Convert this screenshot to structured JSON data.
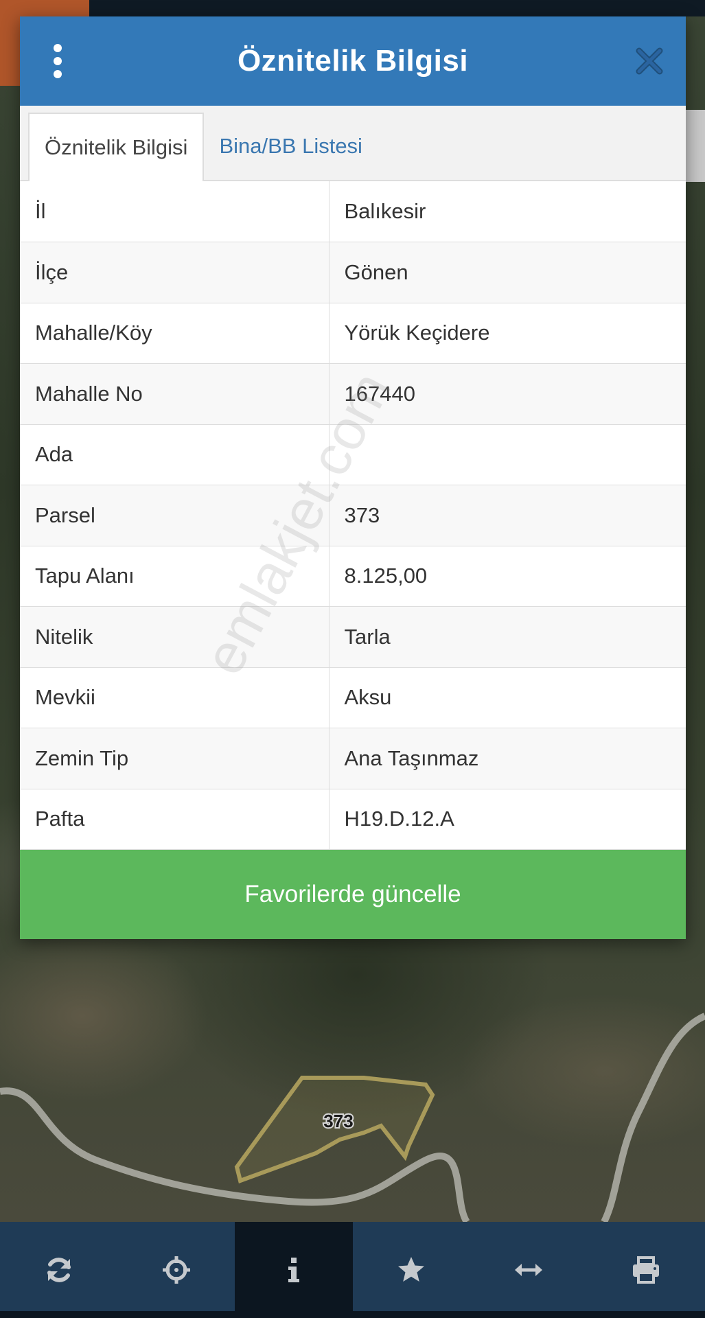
{
  "modal": {
    "title": "Öznitelik Bilgisi",
    "tabs": [
      {
        "label": "Öznitelik Bilgisi",
        "active": true
      },
      {
        "label": "Bina/BB Listesi",
        "active": false
      }
    ],
    "rows": [
      {
        "key": "İl",
        "value": "Balıkesir"
      },
      {
        "key": "İlçe",
        "value": "Gönen"
      },
      {
        "key": "Mahalle/Köy",
        "value": "Yörük Keçidere"
      },
      {
        "key": "Mahalle No",
        "value": "167440"
      },
      {
        "key": "Ada",
        "value": ""
      },
      {
        "key": "Parsel",
        "value": "373"
      },
      {
        "key": "Tapu Alanı",
        "value": "8.125,00"
      },
      {
        "key": "Nitelik",
        "value": "Tarla"
      },
      {
        "key": "Mevkii",
        "value": "Aksu"
      },
      {
        "key": "Zemin Tip",
        "value": "Ana Taşınmaz"
      },
      {
        "key": "Pafta",
        "value": "H19.D.12.A"
      }
    ],
    "favorite_button_label": "Favorilerde güncelle",
    "watermark": "emlakjet.com"
  },
  "map": {
    "parcel_label": "373"
  },
  "toolbar": {
    "items": [
      {
        "icon": "refresh-icon",
        "active": false
      },
      {
        "icon": "crosshairs-icon",
        "active": false
      },
      {
        "icon": "info-icon",
        "active": true
      },
      {
        "icon": "star-icon",
        "active": false
      },
      {
        "icon": "arrows-horizontal-icon",
        "active": false
      },
      {
        "icon": "print-icon",
        "active": false
      }
    ]
  },
  "colors": {
    "header": "#3379b8",
    "favorite_button": "#5cb85c",
    "toolbar": "#1f3b56",
    "toolbar_active": "#0c1620",
    "parcel_outline": "#a89a5a"
  }
}
